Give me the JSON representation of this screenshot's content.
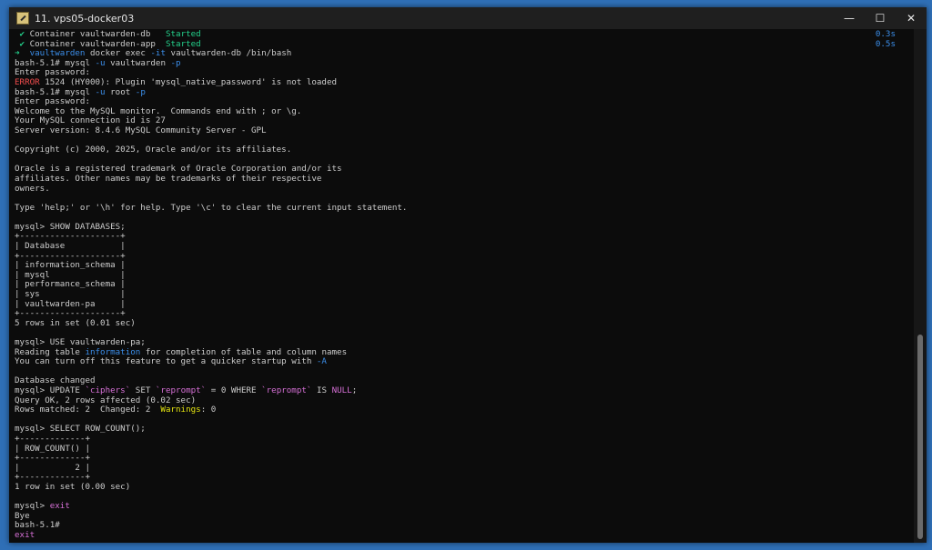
{
  "window": {
    "title": "11. vps05-docker03",
    "minimize": "—",
    "maximize": "☐",
    "close": "✕"
  },
  "terminal": {
    "lines": [
      [
        {
          "t": " ✔ ",
          "c": "g"
        },
        {
          "t": "Container vaultwarden-db   "
        },
        {
          "t": "Started",
          "c": "g"
        },
        {
          "time": "0.3s"
        }
      ],
      [
        {
          "t": " ✔ ",
          "c": "g"
        },
        {
          "t": "Container vaultwarden-app  "
        },
        {
          "t": "Started",
          "c": "g"
        },
        {
          "time": "0.5s"
        }
      ],
      [
        {
          "t": "➜ ",
          "c": "g"
        },
        {
          "t": " vaultwarden",
          "c": "b"
        },
        {
          "t": " docker exec "
        },
        {
          "t": "-it",
          "c": "b"
        },
        {
          "t": " vaultwarden-db /bin/bash"
        }
      ],
      [
        {
          "t": "bash-5.1# mysql "
        },
        {
          "t": "-u",
          "c": "b"
        },
        {
          "t": " vaultwarden "
        },
        {
          "t": "-p",
          "c": "b"
        }
      ],
      [
        {
          "t": "Enter password:"
        }
      ],
      [
        {
          "t": "ERROR",
          "c": "r"
        },
        {
          "t": " 1524 (HY000): Plugin 'mysql_native_password' is not loaded"
        }
      ],
      [
        {
          "t": "bash-5.1# mysql "
        },
        {
          "t": "-u",
          "c": "b"
        },
        {
          "t": " root "
        },
        {
          "t": "-p",
          "c": "b"
        }
      ],
      [
        {
          "t": "Enter password:"
        }
      ],
      [
        {
          "t": "Welcome to the MySQL monitor.  Commands end with ; or \\g."
        }
      ],
      [
        {
          "t": "Your MySQL connection id is 27"
        }
      ],
      [
        {
          "t": "Server version: 8.4.6 MySQL Community Server - GPL"
        }
      ],
      [],
      [
        {
          "t": "Copyright (c) 2000, 2025, Oracle and/or its affiliates."
        }
      ],
      [],
      [
        {
          "t": "Oracle is a registered trademark of Oracle Corporation and/or its"
        }
      ],
      [
        {
          "t": "affiliates. Other names may be trademarks of their respective"
        }
      ],
      [
        {
          "t": "owners."
        }
      ],
      [],
      [
        {
          "t": "Type 'help;' or '\\h' for help. Type '\\c' to clear the current input statement."
        }
      ],
      [],
      [
        {
          "t": "mysql> SHOW DATABASES;"
        }
      ],
      [
        {
          "t": "+--------------------+"
        }
      ],
      [
        {
          "t": "| Database           |"
        }
      ],
      [
        {
          "t": "+--------------------+"
        }
      ],
      [
        {
          "t": "| information_schema |"
        }
      ],
      [
        {
          "t": "| mysql              |"
        }
      ],
      [
        {
          "t": "| performance_schema |"
        }
      ],
      [
        {
          "t": "| sys                |"
        }
      ],
      [
        {
          "t": "| vaultwarden-pa     |"
        }
      ],
      [
        {
          "t": "+--------------------+"
        }
      ],
      [
        {
          "t": "5 rows in set (0.01 sec)"
        }
      ],
      [],
      [
        {
          "t": "mysql> USE vaultwarden-pa;"
        }
      ],
      [
        {
          "t": "Reading table "
        },
        {
          "t": "information",
          "c": "b"
        },
        {
          "t": " for completion of table and column names"
        }
      ],
      [
        {
          "t": "You can turn off this feature to get a quicker startup with "
        },
        {
          "t": "-A",
          "c": "b"
        }
      ],
      [],
      [
        {
          "t": "Database changed"
        }
      ],
      [
        {
          "t": "mysql> UPDATE "
        },
        {
          "t": "`ciphers`",
          "c": "m"
        },
        {
          "t": " SET "
        },
        {
          "t": "`reprompt`",
          "c": "m"
        },
        {
          "t": " = 0 WHERE "
        },
        {
          "t": "`reprompt`",
          "c": "m"
        },
        {
          "t": " IS "
        },
        {
          "t": "NULL",
          "c": "m"
        },
        {
          "t": ";"
        }
      ],
      [
        {
          "t": "Query OK, 2 rows affected (0.02 sec)"
        }
      ],
      [
        {
          "t": "Rows matched: 2  Changed: 2  "
        },
        {
          "t": "Warnings",
          "c": "y"
        },
        {
          "t": ": 0"
        }
      ],
      [],
      [
        {
          "t": "mysql> SELECT ROW_COUNT();"
        }
      ],
      [
        {
          "t": "+-------------+"
        }
      ],
      [
        {
          "t": "| ROW_COUNT() |"
        }
      ],
      [
        {
          "t": "+-------------+"
        }
      ],
      [
        {
          "t": "|           2 |"
        }
      ],
      [
        {
          "t": "+-------------+"
        }
      ],
      [
        {
          "t": "1 row in set (0.00 sec)"
        }
      ],
      [],
      [
        {
          "t": "mysql> "
        },
        {
          "t": "exit",
          "c": "m"
        }
      ],
      [
        {
          "t": "Bye"
        }
      ],
      [
        {
          "t": "bash-5.1#"
        }
      ],
      [
        {
          "t": "exit",
          "c": "m"
        }
      ]
    ]
  }
}
